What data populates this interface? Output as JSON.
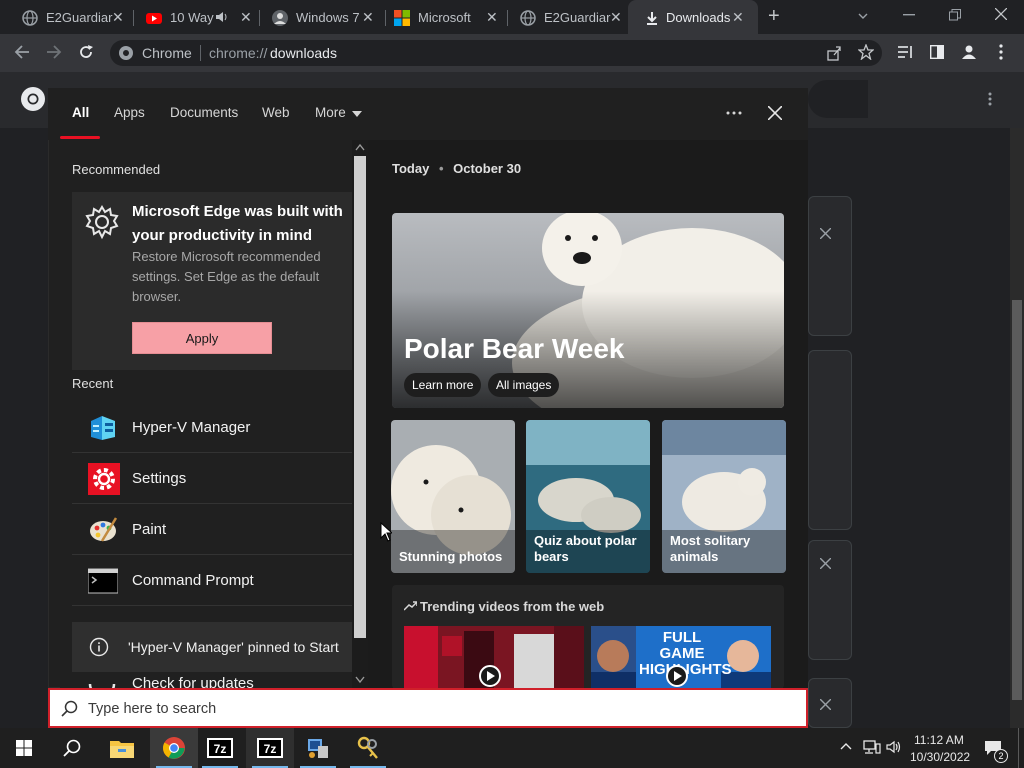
{
  "browser": {
    "tabs": [
      {
        "label": "E2Guardiar",
        "icon": "globe-icon",
        "active": false
      },
      {
        "label": "10 Way",
        "icon": "youtube-icon",
        "active": false,
        "audio": true
      },
      {
        "label": "Windows 7",
        "icon": "avatar-icon",
        "active": false
      },
      {
        "label": "Microsoft",
        "icon": "microsoft-logo-icon",
        "active": false
      },
      {
        "label": "E2Guardiar",
        "icon": "globe-icon",
        "active": false
      },
      {
        "label": "Downloads",
        "icon": "download-icon",
        "active": true
      }
    ],
    "new_tab_symbol": "+",
    "close_symbol": "✕",
    "omnibox": {
      "site_label": "Chrome",
      "url_prefix": "chrome://",
      "url_host": "downloads"
    }
  },
  "search_flyout": {
    "tabs": [
      "All",
      "Apps",
      "Documents",
      "Web",
      "More"
    ],
    "recommended_heading": "Recommended",
    "recommended": {
      "title": "Microsoft Edge was built with your productivity in mind",
      "body": "Restore Microsoft recommended settings. Set Edge as the default browser.",
      "button": "Apply"
    },
    "recent_heading": "Recent",
    "recent_items": [
      {
        "label": "Hyper-V Manager",
        "icon": "hyper-v-icon"
      },
      {
        "label": "Settings",
        "icon": "settings-gear-icon"
      },
      {
        "label": "Paint",
        "icon": "paint-palette-icon"
      },
      {
        "label": "Command Prompt",
        "icon": "command-prompt-icon"
      }
    ],
    "partial_item": "Check for updates",
    "toast": "'Hyper-V Manager' pinned to Start",
    "date_prefix": "Today",
    "date": "October 30",
    "hero_title": "Polar Bear Week",
    "hero_buttons": [
      "Learn more",
      "All images"
    ],
    "tiles": [
      "Stunning photos",
      "Quiz about polar bears",
      "Most solitary animals"
    ],
    "trending_heading": "Trending videos from the web",
    "video_caption": "FULL GAME HIGHLIGHTS"
  },
  "searchbox": {
    "placeholder": "Type here to search"
  },
  "taskbar": {
    "apps": [
      "file-explorer-icon",
      "chrome-icon",
      "7zip-icon",
      "7zip-icon",
      "network-admin-icon",
      "keys-icon"
    ],
    "time": "11:12 AM",
    "date": "10/30/2022",
    "notification_count": "2"
  },
  "colors": {
    "accent": "#e81123",
    "apply": "#f7a0a6",
    "taskbar": "#1f1f1f"
  }
}
